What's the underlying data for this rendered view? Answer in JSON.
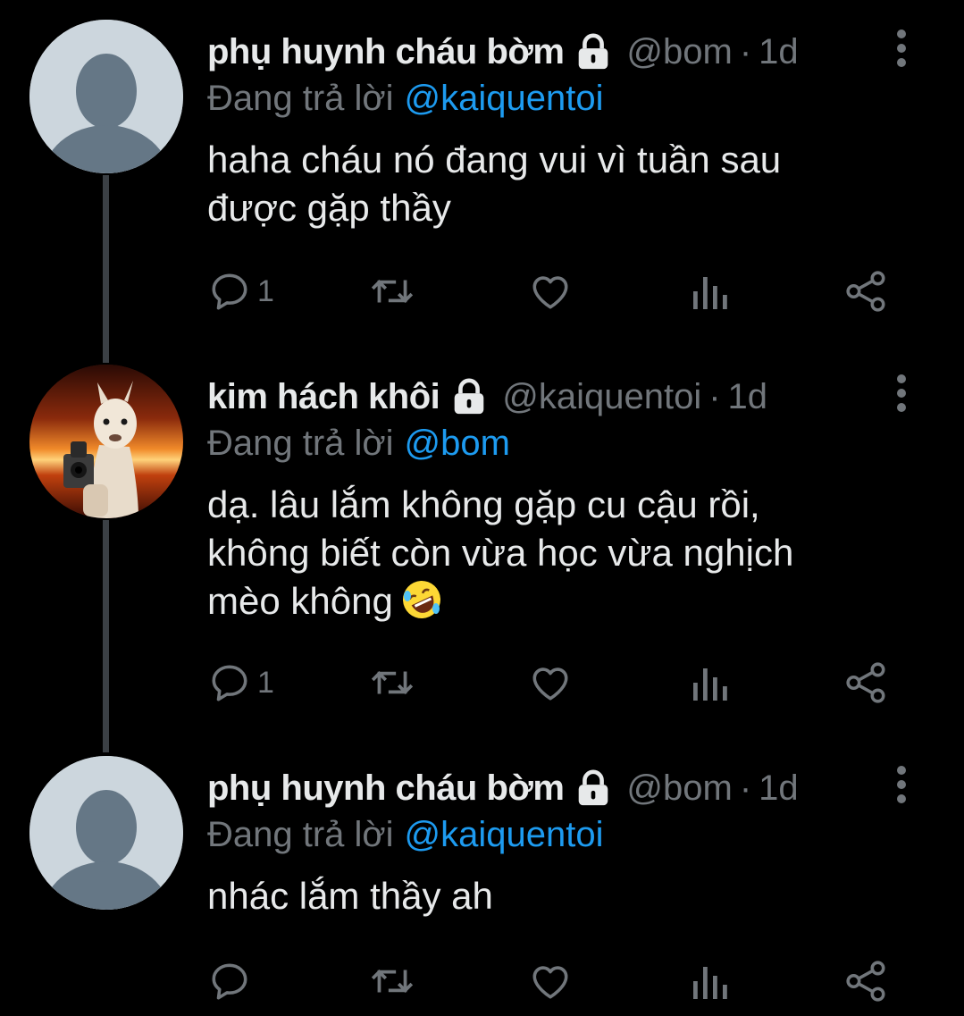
{
  "colors": {
    "background": "#000000",
    "text_primary": "#e7e9ea",
    "text_secondary": "#71767b",
    "accent_link": "#1d9bf0",
    "thread_line": "#3b4045",
    "default_avatar_bg": "#ccd6dd",
    "default_avatar_fg": "#657786"
  },
  "tweets": [
    {
      "display_name": "phụ huynh cháu bờm",
      "protected_icon": "lock-icon",
      "handle": "@bom",
      "separator": "·",
      "time": "1d",
      "reply_label": "Đang trả lời",
      "reply_to": "@kaiquentoi",
      "text_lines": [
        "haha cháu nó đang vui vì tuần sau",
        "được gặp thầy"
      ],
      "emoji": "",
      "replies": "1",
      "avatar": "default-avatar"
    },
    {
      "display_name": "kim hách khôi",
      "protected_icon": "lock-icon",
      "handle": "@kaiquentoi",
      "separator": "·",
      "time": "1d",
      "reply_label": "Đang trả lời",
      "reply_to": "@bom",
      "text_lines": [
        "dạ. lâu lắm không gặp cu cậu rồi,",
        "không biết còn vừa học vừa nghịch",
        "mèo không"
      ],
      "emoji": "rolling-on-floor-laughing-emoji",
      "replies": "1",
      "avatar": "alpaca-with-gun-photo"
    },
    {
      "display_name": "phụ huynh cháu bờm",
      "protected_icon": "lock-icon",
      "handle": "@bom",
      "separator": "·",
      "time": "1d",
      "reply_label": "Đang trả lời",
      "reply_to": "@kaiquentoi",
      "text_lines": [
        "nhác lắm thầy ah"
      ],
      "emoji": "",
      "replies": "",
      "avatar": "default-avatar"
    }
  ],
  "action_icons": [
    "reply-icon",
    "retweet-icon",
    "like-icon",
    "analytics-icon",
    "share-icon"
  ]
}
